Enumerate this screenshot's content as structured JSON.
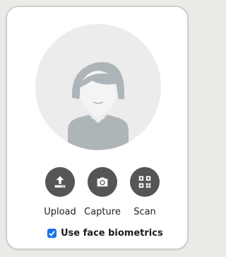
{
  "profile": {
    "avatar_icon": "default-person-avatar"
  },
  "actions": [
    {
      "label": "Upload",
      "icon": "upload-icon"
    },
    {
      "label": "Capture",
      "icon": "camera-icon"
    },
    {
      "label": "Scan",
      "icon": "qr-code-icon"
    }
  ],
  "biometrics": {
    "label": "Use face biometrics",
    "checked": true
  },
  "colors": {
    "button_bg": "#555555",
    "checkbox_bg": "#1a73e8",
    "avatar_bg": "#ececec",
    "avatar_figure": "#aeb5b9"
  }
}
